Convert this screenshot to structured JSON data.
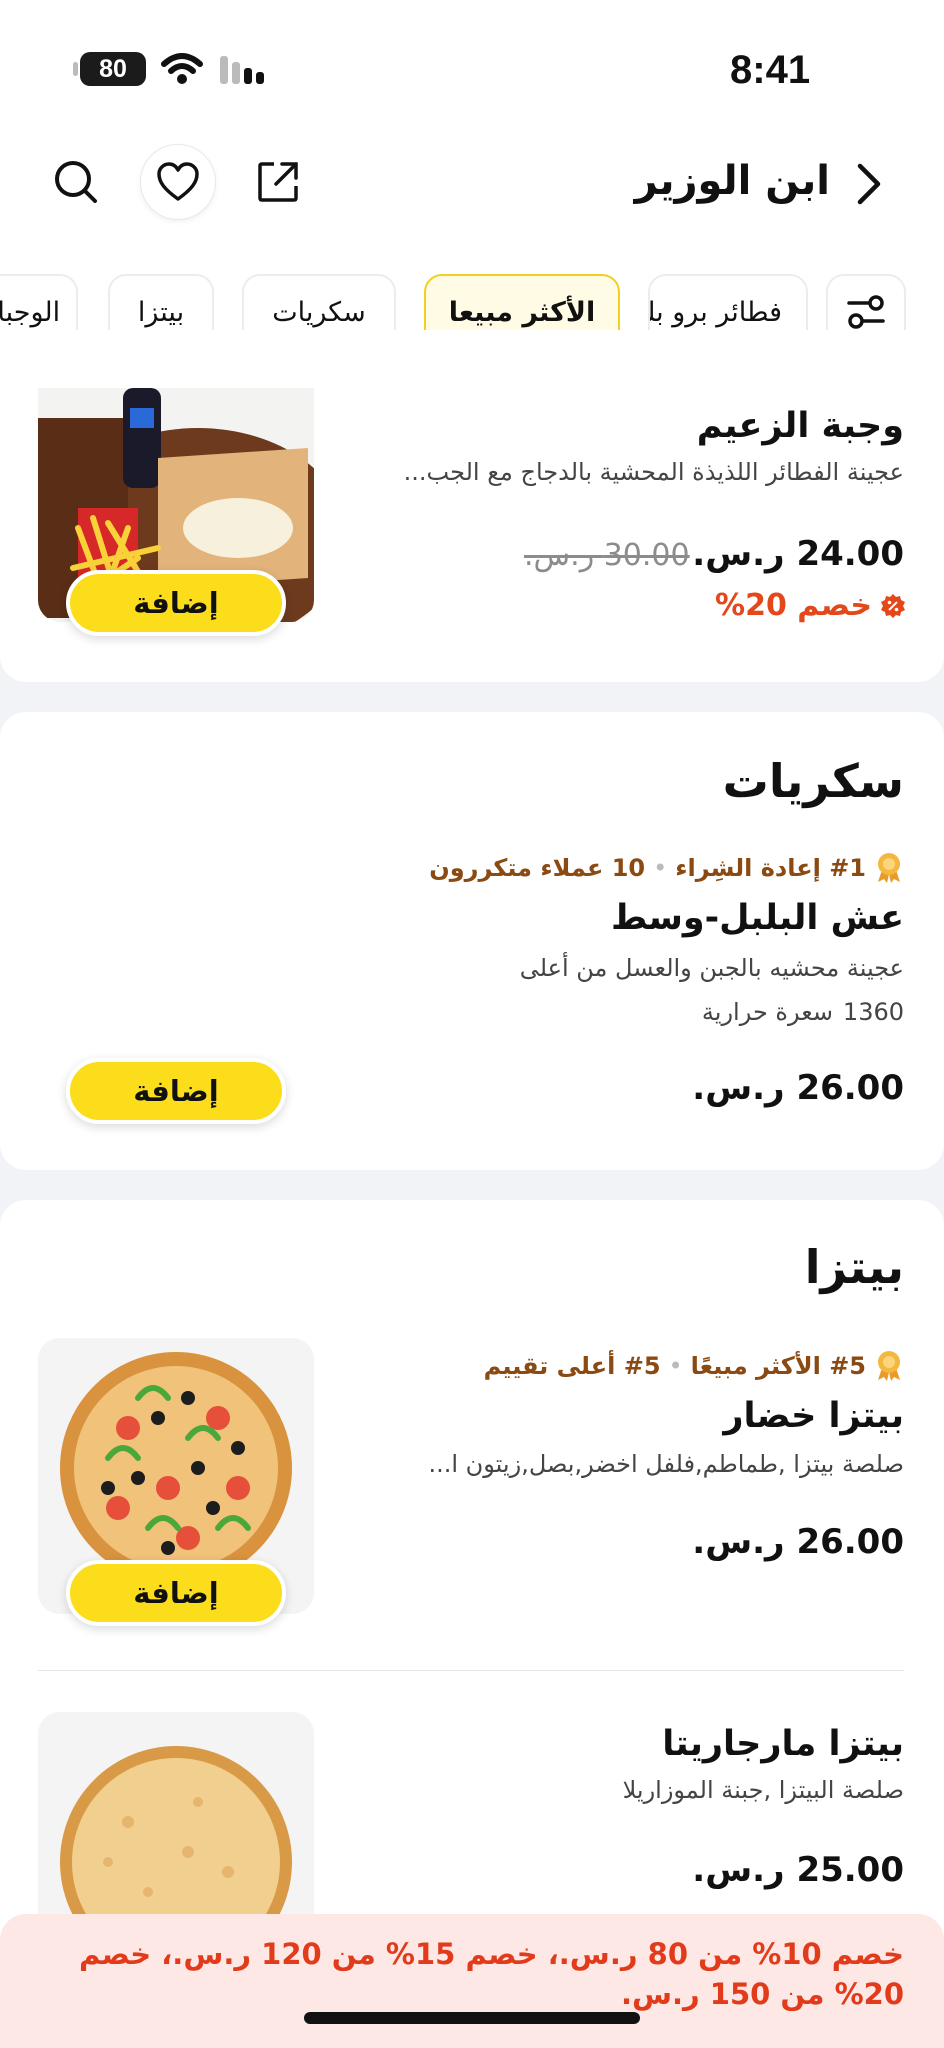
{
  "status_bar": {
    "time": "8:41",
    "battery": "80"
  },
  "header": {
    "store_name": "ابن الوزير"
  },
  "tabs": [
    {
      "label": "فطائر برو بلس"
    },
    {
      "label": "الأكثر مبيعا",
      "active": true
    },
    {
      "label": "سكريات"
    },
    {
      "label": "بيتزا"
    },
    {
      "label": "الوجبات"
    }
  ],
  "top_item": {
    "name": "وجبة الزعيم",
    "description": "عجينة الفطائر اللذيذة المحشية بالدجاج مع الجب...",
    "price": "24.00 ر.س.",
    "old_price": "30.00 ر.س.",
    "discount": "خصم 20%",
    "add_label": "إضافة"
  },
  "sweets_section": {
    "title": "سكريات",
    "item": {
      "badge_rank": "#1 إعادة الشِراء",
      "badge_extra": "10 عملاء متكررون",
      "name": "عش البلبل-وسط",
      "description": "عجينة محشيه بالجبن والعسل من أعلى",
      "calories_value": "1360",
      "calories_unit": "سعرة حرارية",
      "price": "26.00 ر.س.",
      "add_label": "إضافة"
    }
  },
  "pizza_section": {
    "title": "بيتزا",
    "items": [
      {
        "badge_rank": "#5 الأكثر مبيعًا",
        "badge_extra": "#5 أعلى تقييم",
        "name": "بيتزا خضار",
        "description": "صلصة بيتزا ,طماطم,فلفل اخضر,بصل,زيتون ا...",
        "price": "26.00 ر.س.",
        "add_label": "إضافة"
      },
      {
        "name": "بيتزا مارجاريتا",
        "description": "صلصة البيتزا ,جبنة الموزاريلا",
        "price": "25.00 ر.س."
      }
    ]
  },
  "offer_banner": {
    "text": "خصم 10% من 80 ر.س.، خصم 15% من 120 ر.س.، خصم 20% من 150 ر.س."
  },
  "colors": {
    "accent": "#fbdd1c",
    "discount": "#e4471a",
    "badge": "#8a4a12"
  },
  "icons": [
    "search-icon",
    "heart-icon",
    "share-icon",
    "back-chevron-icon",
    "filter-icon",
    "award-icon",
    "discount-icon"
  ]
}
